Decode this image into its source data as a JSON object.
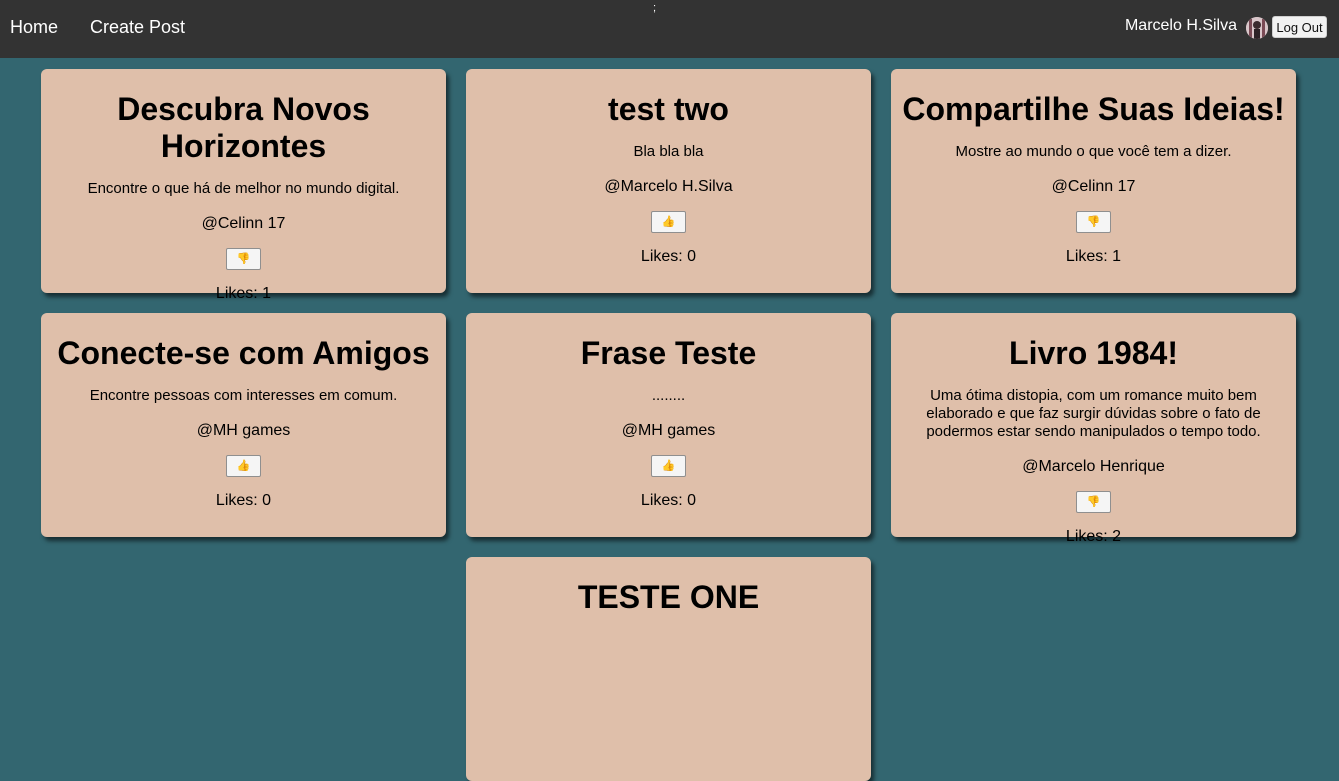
{
  "nav": {
    "home": "Home",
    "create_post": "Create Post",
    "dot": ";",
    "username": "Marcelo H.Silva",
    "logout": "Log Out",
    "avatar_icon": "user-avatar"
  },
  "posts": [
    {
      "title": "Descubra Novos Horizontes",
      "text": "Encontre o que há de melhor no mundo digital.",
      "author": "@Celinn 17",
      "like_icon": "👎",
      "likes": "Likes: 1"
    },
    {
      "title": "test two",
      "text": "Bla bla bla",
      "author": "@Marcelo H.Silva",
      "like_icon": "👍",
      "likes": "Likes: 0"
    },
    {
      "title": "Compartilhe Suas Ideias!",
      "text": "Mostre ao mundo o que você tem a dizer.",
      "author": "@Celinn 17",
      "like_icon": "👎",
      "likes": "Likes: 1"
    },
    {
      "title": "Conecte-se com Amigos",
      "text": "Encontre pessoas com interesses em comum.",
      "author": "@MH games",
      "like_icon": "👍",
      "likes": "Likes: 0"
    },
    {
      "title": "Frase Teste",
      "text": "........",
      "author": "@MH games",
      "like_icon": "👍",
      "likes": "Likes: 0"
    },
    {
      "title": "Livro 1984!",
      "text": "Uma ótima distopia, com um romance muito bem elaborado e que faz surgir dúvidas sobre o fato de podermos estar sendo manipulados o tempo todo.",
      "author": "@Marcelo Henrique",
      "like_icon": "👎",
      "likes": "Likes: 2"
    },
    {
      "title": "TESTE ONE"
    }
  ],
  "colors": {
    "background": "#336670",
    "navbar": "#333333",
    "card": "#dfbfaa"
  }
}
